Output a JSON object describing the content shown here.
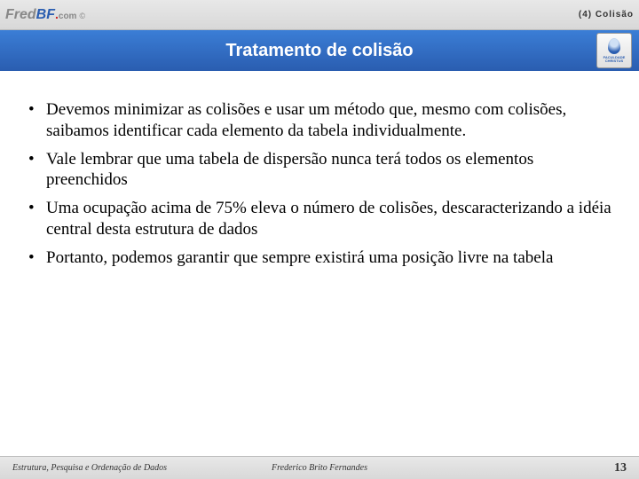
{
  "header": {
    "logo": {
      "fred": "Fred",
      "bf": "BF",
      "dot": ".",
      "com": "com",
      "c": "©"
    },
    "section": "(4) Colisão"
  },
  "title": "Tratamento de colisão",
  "badge": {
    "line1": "FACULDADE",
    "line2": "CHRISTUS"
  },
  "bullets": [
    "Devemos minimizar as colisões e usar um método que, mesmo com colisões, saibamos identificar cada elemento da tabela individualmente.",
    "Vale lembrar que uma tabela de dispersão nunca terá todos os elementos preenchidos",
    "Uma ocupação acima de 75% eleva o número de colisões, descaracterizando a idéia central desta estrutura de dados",
    "Portanto, podemos garantir que sempre existirá uma posição livre na tabela"
  ],
  "footer": {
    "left": "Estrutura, Pesquisa e Ordenação de Dados",
    "center": "Frederico Brito Fernandes",
    "page": "13"
  }
}
